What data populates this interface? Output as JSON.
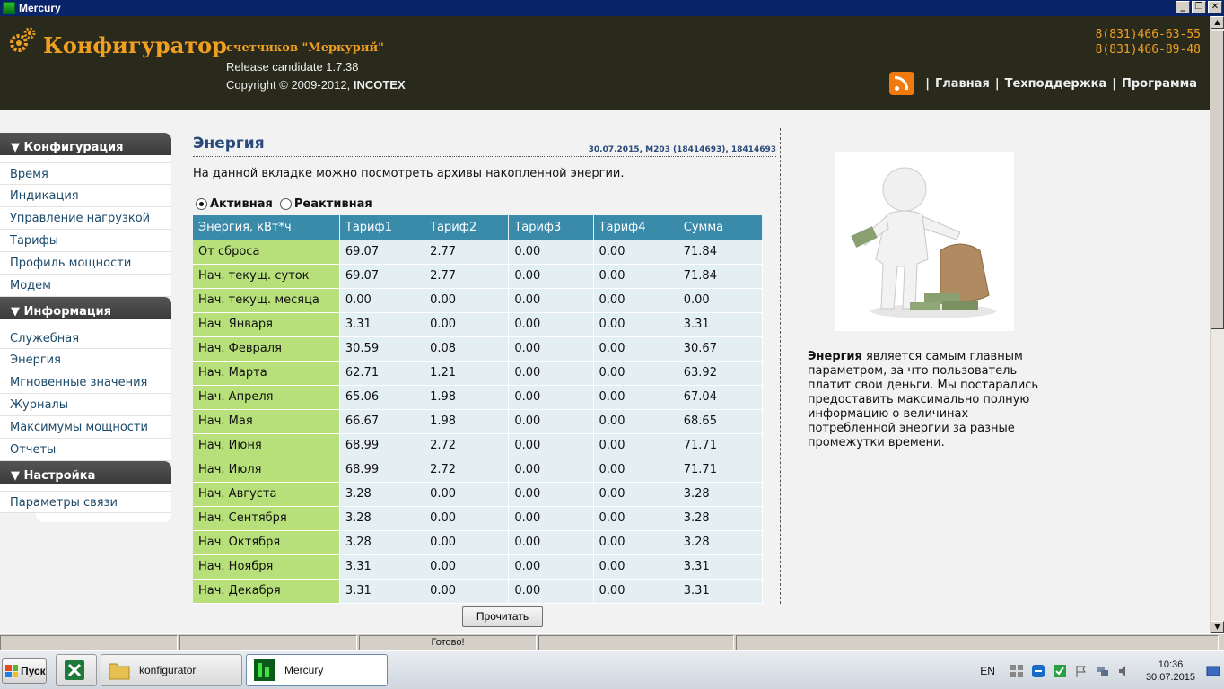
{
  "window": {
    "title": "Mercury",
    "controls": [
      "_",
      "❐",
      "✕"
    ]
  },
  "header": {
    "brand_title": "Конфигуратор",
    "brand_sub": "счетчиков \"Меркурий\"",
    "release": "Release candidate 1.7.38",
    "copyright_prefix": "Copyright © 2009-2012,",
    "copyright_company": "INCOTEX",
    "phones": [
      "8(831)466-63-55",
      "8(831)466-89-48"
    ],
    "nav_separator": "|",
    "nav": [
      "Главная",
      "Техподдержка",
      "Программа"
    ],
    "accent_color": "#f0a020"
  },
  "sidebar": {
    "sections": [
      {
        "title": "▼ Конфигурация",
        "items": [
          "Время",
          "Индикация",
          "Управление нагрузкой",
          "Тарифы",
          "Профиль мощности",
          "Модем"
        ]
      },
      {
        "title": "▼ Информация",
        "items": [
          "Служебная",
          "Энергия",
          "Мгновенные значения",
          "Журналы",
          "Максимумы мощности",
          "Отчеты"
        ]
      },
      {
        "title": "▼ Настройка",
        "items": [
          "Параметры связи"
        ]
      }
    ]
  },
  "main": {
    "title": "Энергия",
    "device_info": "30.07.2015, M203 (18414693), 18414693",
    "description": "На данной вкладке можно посмотреть архивы накопленной энергии.",
    "radios": [
      {
        "label": "Активная",
        "checked": true
      },
      {
        "label": "Реактивная",
        "checked": false
      }
    ],
    "table": {
      "headers": [
        "Энергия, кВт*ч",
        "Тариф1",
        "Тариф2",
        "Тариф3",
        "Тариф4",
        "Сумма"
      ],
      "rows": [
        [
          "От сброса",
          "69.07",
          "2.77",
          "0.00",
          "0.00",
          "71.84"
        ],
        [
          "Нач. текущ. суток",
          "69.07",
          "2.77",
          "0.00",
          "0.00",
          "71.84"
        ],
        [
          "Нач. текущ. месяца",
          "0.00",
          "0.00",
          "0.00",
          "0.00",
          "0.00"
        ],
        [
          "Нач. Января",
          "3.31",
          "0.00",
          "0.00",
          "0.00",
          "3.31"
        ],
        [
          "Нач. Февраля",
          "30.59",
          "0.08",
          "0.00",
          "0.00",
          "30.67"
        ],
        [
          "Нач. Марта",
          "62.71",
          "1.21",
          "0.00",
          "0.00",
          "63.92"
        ],
        [
          "Нач. Апреля",
          "65.06",
          "1.98",
          "0.00",
          "0.00",
          "67.04"
        ],
        [
          "Нач. Мая",
          "66.67",
          "1.98",
          "0.00",
          "0.00",
          "68.65"
        ],
        [
          "Нач. Июня",
          "68.99",
          "2.72",
          "0.00",
          "0.00",
          "71.71"
        ],
        [
          "Нач. Июля",
          "68.99",
          "2.72",
          "0.00",
          "0.00",
          "71.71"
        ],
        [
          "Нач. Августа",
          "3.28",
          "0.00",
          "0.00",
          "0.00",
          "3.28"
        ],
        [
          "Нач. Сентября",
          "3.28",
          "0.00",
          "0.00",
          "0.00",
          "3.28"
        ],
        [
          "Нач. Октября",
          "3.28",
          "0.00",
          "0.00",
          "0.00",
          "3.28"
        ],
        [
          "Нач. Ноября",
          "3.31",
          "0.00",
          "0.00",
          "0.00",
          "3.31"
        ],
        [
          "Нач. Декабря",
          "3.31",
          "0.00",
          "0.00",
          "0.00",
          "3.31"
        ]
      ]
    },
    "read_button": "Прочитать"
  },
  "side_panel": {
    "bold_word": "Энергия",
    "text": " является самым главным параметром, за что пользователь платит свои деньги. Мы постарались предоставить максимально полную информацию о величинах потребленной энергии за разные промежутки времени."
  },
  "statusbar": {
    "status": "Готово!"
  },
  "taskbar": {
    "start": "Пуск",
    "items": [
      {
        "label": "",
        "icon": "excel-icon"
      },
      {
        "label": "konfigurator",
        "icon": "folder-icon"
      },
      {
        "label": "Mercury",
        "icon": "mercury-app-icon",
        "active": true
      }
    ],
    "lang": "EN",
    "time": "10:36",
    "date": "30.07.2015"
  }
}
